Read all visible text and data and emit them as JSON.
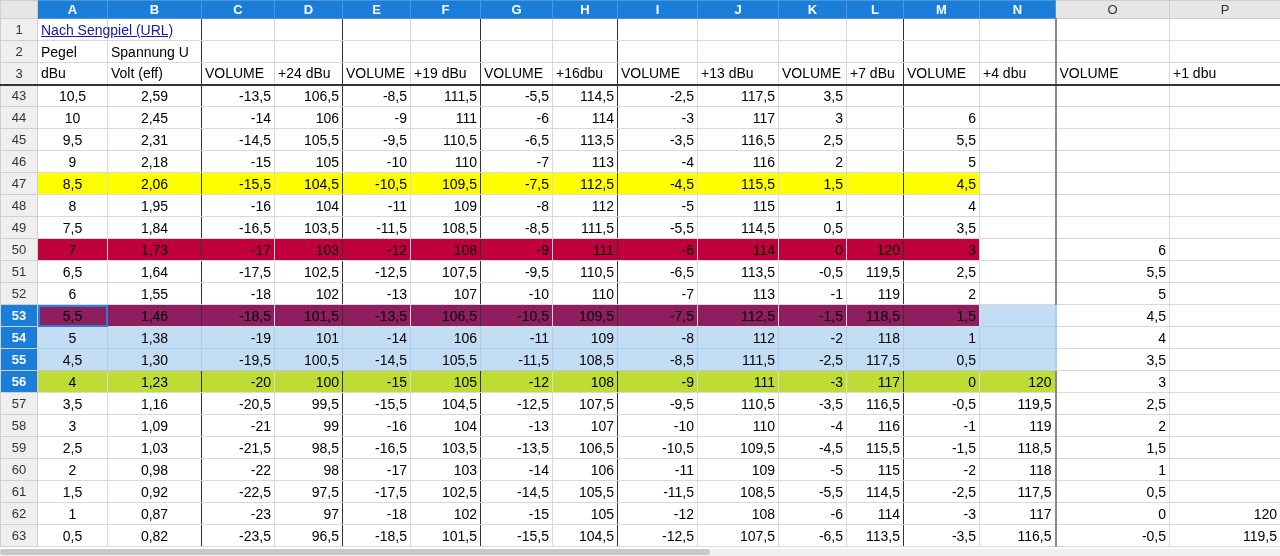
{
  "columns": [
    {
      "label": "A",
      "selected": true
    },
    {
      "label": "B",
      "selected": true
    },
    {
      "label": "C",
      "selected": true
    },
    {
      "label": "D",
      "selected": true
    },
    {
      "label": "E",
      "selected": true
    },
    {
      "label": "F",
      "selected": true
    },
    {
      "label": "G",
      "selected": true
    },
    {
      "label": "H",
      "selected": true
    },
    {
      "label": "I",
      "selected": true
    },
    {
      "label": "J",
      "selected": true
    },
    {
      "label": "K",
      "selected": true
    },
    {
      "label": "L",
      "selected": true
    },
    {
      "label": "M",
      "selected": true
    },
    {
      "label": "N",
      "selected": true
    },
    {
      "label": "O",
      "selected": false
    },
    {
      "label": "P",
      "selected": false
    }
  ],
  "rows": [
    {
      "number": "1",
      "kind": "link",
      "selected": false,
      "cells": [
        "Nach Sengpiel (URL)"
      ]
    },
    {
      "number": "2",
      "kind": "header",
      "selected": false,
      "cells": [
        "Pegel",
        "Spannung U"
      ]
    },
    {
      "number": "3",
      "kind": "header",
      "selected": false,
      "cells": [
        "dBu",
        "Volt (eff)",
        "VOLUME",
        "+24 dBu",
        "VOLUME",
        "+19 dBu",
        "VOLUME",
        "+16dbu",
        "VOLUME",
        "+13 dBu",
        "VOLUME",
        "+7 dBu",
        "VOLUME",
        "+4 dbu",
        "VOLUME",
        "+1 dbu"
      ]
    },
    {
      "number": "43",
      "kind": "data",
      "selected": false,
      "cells": [
        "10,5",
        "2,59",
        "-13,5",
        "106,5",
        "-8,5",
        "111,5",
        "-5,5",
        "114,5",
        "-2,5",
        "117,5",
        "3,5"
      ]
    },
    {
      "number": "44",
      "kind": "data",
      "selected": false,
      "cells": [
        "10",
        "2,45",
        "-14",
        "106",
        "-9",
        "111",
        "-6",
        "114",
        "-3",
        "117",
        "3",
        null,
        "6"
      ]
    },
    {
      "number": "45",
      "kind": "data",
      "selected": false,
      "cells": [
        "9,5",
        "2,31",
        "-14,5",
        "105,5",
        "-9,5",
        "110,5",
        "-6,5",
        "113,5",
        "-3,5",
        "116,5",
        "2,5",
        null,
        "5,5"
      ]
    },
    {
      "number": "46",
      "kind": "data",
      "selected": false,
      "cells": [
        "9",
        "2,18",
        "-15",
        "105",
        "-10",
        "110",
        "-7",
        "113",
        "-4",
        "116",
        "2",
        null,
        "5"
      ]
    },
    {
      "number": "47",
      "kind": "data",
      "selected": false,
      "color": "#ffff00",
      "cells": [
        "8,5",
        "2,06",
        "-15,5",
        "104,5",
        "-10,5",
        "109,5",
        "-7,5",
        "112,5",
        "-4,5",
        "115,5",
        "1,5",
        null,
        "4,5"
      ]
    },
    {
      "number": "48",
      "kind": "data",
      "selected": false,
      "cells": [
        "8",
        "1,95",
        "-16",
        "104",
        "-11",
        "109",
        "-8",
        "112",
        "-5",
        "115",
        "1",
        null,
        "4"
      ]
    },
    {
      "number": "49",
      "kind": "data",
      "selected": false,
      "cells": [
        "7,5",
        "1,84",
        "-16,5",
        "103,5",
        "-11,5",
        "108,5",
        "-8,5",
        "111,5",
        "-5,5",
        "114,5",
        "0,5",
        null,
        "3,5"
      ]
    },
    {
      "number": "50",
      "kind": "data",
      "selected": false,
      "color": "#c0003c",
      "cells": [
        "7",
        "1,73",
        "-17",
        "103",
        "-12",
        "108",
        "-9",
        "111",
        "-6",
        "114",
        "0",
        "120",
        "3",
        null,
        "6"
      ]
    },
    {
      "number": "51",
      "kind": "data",
      "selected": false,
      "cells": [
        "6,5",
        "1,64",
        "-17,5",
        "102,5",
        "-12,5",
        "107,5",
        "-9,5",
        "110,5",
        "-6,5",
        "113,5",
        "-0,5",
        "119,5",
        "2,5",
        null,
        "5,5"
      ]
    },
    {
      "number": "52",
      "kind": "data",
      "selected": false,
      "cells": [
        "6",
        "1,55",
        "-18",
        "102",
        "-13",
        "107",
        "-10",
        "110",
        "-7",
        "113",
        "-1",
        "119",
        "2",
        null,
        "5"
      ]
    },
    {
      "number": "53",
      "kind": "data",
      "selected": true,
      "active": true,
      "color": "#8e1e60",
      "cells": [
        "5,5",
        "1,46",
        "-18,5",
        "101,5",
        "-13,5",
        "106,5",
        "-10,5",
        "109,5",
        "-7,5",
        "112,5",
        "-1,5",
        "118,5",
        "1,5",
        null,
        "4,5"
      ]
    },
    {
      "number": "54",
      "kind": "data",
      "selected": true,
      "cells": [
        "5",
        "1,38",
        "-19",
        "101",
        "-14",
        "106",
        "-11",
        "109",
        "-8",
        "112",
        "-2",
        "118",
        "1",
        null,
        "4"
      ]
    },
    {
      "number": "55",
      "kind": "data",
      "selected": true,
      "cells": [
        "4,5",
        "1,30",
        "-19,5",
        "100,5",
        "-14,5",
        "105,5",
        "-11,5",
        "108,5",
        "-8,5",
        "111,5",
        "-2,5",
        "117,5",
        "0,5",
        null,
        "3,5"
      ]
    },
    {
      "number": "56",
      "kind": "data",
      "selected": true,
      "color": "#bfdc34",
      "cells": [
        "4",
        "1,23",
        "-20",
        "100",
        "-15",
        "105",
        "-12",
        "108",
        "-9",
        "111",
        "-3",
        "117",
        "0",
        "120",
        "3"
      ]
    },
    {
      "number": "57",
      "kind": "data",
      "selected": false,
      "cells": [
        "3,5",
        "1,16",
        "-20,5",
        "99,5",
        "-15,5",
        "104,5",
        "-12,5",
        "107,5",
        "-9,5",
        "110,5",
        "-3,5",
        "116,5",
        "-0,5",
        "119,5",
        "2,5"
      ]
    },
    {
      "number": "58",
      "kind": "data",
      "selected": false,
      "cells": [
        "3",
        "1,09",
        "-21",
        "99",
        "-16",
        "104",
        "-13",
        "107",
        "-10",
        "110",
        "-4",
        "116",
        "-1",
        "119",
        "2"
      ]
    },
    {
      "number": "59",
      "kind": "data",
      "selected": false,
      "cells": [
        "2,5",
        "1,03",
        "-21,5",
        "98,5",
        "-16,5",
        "103,5",
        "-13,5",
        "106,5",
        "-10,5",
        "109,5",
        "-4,5",
        "115,5",
        "-1,5",
        "118,5",
        "1,5"
      ]
    },
    {
      "number": "60",
      "kind": "data",
      "selected": false,
      "cells": [
        "2",
        "0,98",
        "-22",
        "98",
        "-17",
        "103",
        "-14",
        "106",
        "-11",
        "109",
        "-5",
        "115",
        "-2",
        "118",
        "1"
      ]
    },
    {
      "number": "61",
      "kind": "data",
      "selected": false,
      "cells": [
        "1,5",
        "0,92",
        "-22,5",
        "97,5",
        "-17,5",
        "102,5",
        "-14,5",
        "105,5",
        "-11,5",
        "108,5",
        "-5,5",
        "114,5",
        "-2,5",
        "117,5",
        "0,5"
      ]
    },
    {
      "number": "62",
      "kind": "data",
      "selected": false,
      "cells": [
        "1",
        "0,87",
        "-23",
        "97",
        "-18",
        "102",
        "-15",
        "105",
        "-12",
        "108",
        "-6",
        "114",
        "-3",
        "117",
        "0",
        "120"
      ]
    },
    {
      "number": "63",
      "kind": "data",
      "selected": false,
      "cells": [
        "0,5",
        "0,82",
        "-23,5",
        "96,5",
        "-18,5",
        "101,5",
        "-15,5",
        "104,5",
        "-12,5",
        "107,5",
        "-6,5",
        "113,5",
        "-3,5",
        "116,5",
        "-0,5",
        "119,5"
      ]
    }
  ]
}
